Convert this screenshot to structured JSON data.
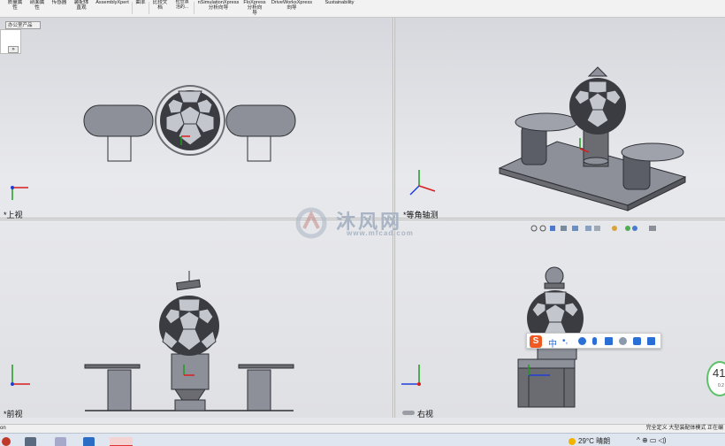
{
  "ribbon": {
    "items": [
      {
        "label": "质量属\n性"
      },
      {
        "label": "剖面属\n性"
      },
      {
        "label": "传感器"
      },
      {
        "label": "装配体\n直观"
      },
      {
        "label": "AssemblyXpert"
      },
      {
        "label": "曲率"
      },
      {
        "label": "比较文\n档"
      },
      {
        "label": "检查激\n活的..."
      },
      {
        "label": "nSimulationXpress\n分析向导"
      },
      {
        "label": "FloXpress\n分析向\n导"
      },
      {
        "label": "DriveWorksXpress\n向导"
      },
      {
        "label": "Sustainability"
      }
    ]
  },
  "config_tab": "办公室产品",
  "mini_chevron": "»",
  "views": {
    "top": "*上视",
    "isometric": "*等角轴测",
    "front": "*前视",
    "right": "右视"
  },
  "watermark": {
    "text": "沐风网",
    "url": "www.mfcad.com"
  },
  "ime": {
    "logo": "S",
    "lang": "中",
    "punct": "•,"
  },
  "badge": {
    "num": "41",
    "sub": "0.2"
  },
  "status": {
    "left": "on",
    "right": "完全定义   大型装配体模式   正在编"
  },
  "taskbar": {
    "weather": "29°C  晴朗",
    "tray": "^ ⊕ ▭ ◁)"
  },
  "colors": {
    "triad_x": "#d81e1e",
    "triad_y": "#1f9a1f",
    "triad_z": "#1f3fd8",
    "model_fill": "#8d9099",
    "model_dark": "#3a3c42",
    "accent": "#f05a22"
  }
}
